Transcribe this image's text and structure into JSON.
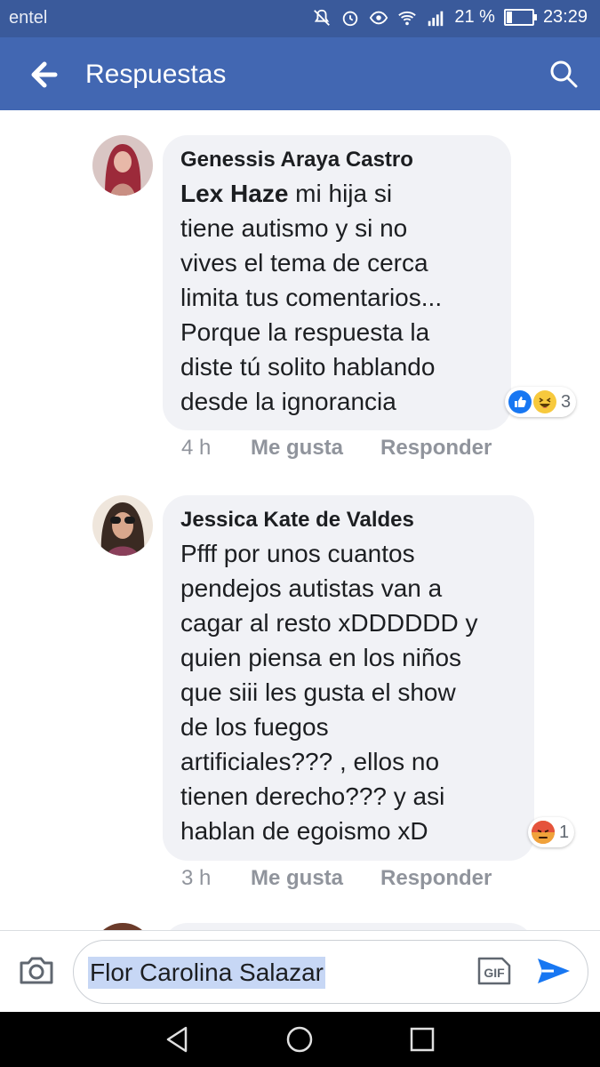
{
  "status_bar": {
    "carrier": "entel",
    "battery": "21 %",
    "time": "23:29"
  },
  "header": {
    "title": "Respuestas"
  },
  "comments": [
    {
      "author": "Genessis Araya Castro",
      "mention": "Lex Haze",
      "text_lines": [
        " mi hija  si",
        "tiene autismo y si no",
        "vives el tema de cerca",
        "limita tus comentarios...",
        "Porque la respuesta la",
        "diste tú solito hablando",
        "desde la ignorancia"
      ],
      "time": "4 h",
      "like_label": "Me gusta",
      "reply_label": "Responder",
      "reactions": [
        "like-icon",
        "haha-icon"
      ],
      "reaction_count": "3"
    },
    {
      "author": "Jessica Kate de Valdes",
      "text_lines": [
        "Pfff por unos cuantos",
        "pendejos autistas van a",
        "cagar al resto xDDDDDD  y",
        "quien piensa en los niños",
        "que siii les gusta el show",
        "de los fuegos",
        "artificiales??? , ellos no",
        "tienen derecho??? y asi",
        "hablan de egoismo xD"
      ],
      "time": "3 h",
      "like_label": "Me gusta",
      "reply_label": "Responder",
      "reactions": [
        "angry-icon"
      ],
      "reaction_count": "1"
    }
  ],
  "composer": {
    "value": "Flor Carolina Salazar",
    "gif_label": "GIF"
  },
  "colors": {
    "header_bg": "#4267b2",
    "like_blue": "#1877f2",
    "meta_gray": "#90949c"
  }
}
